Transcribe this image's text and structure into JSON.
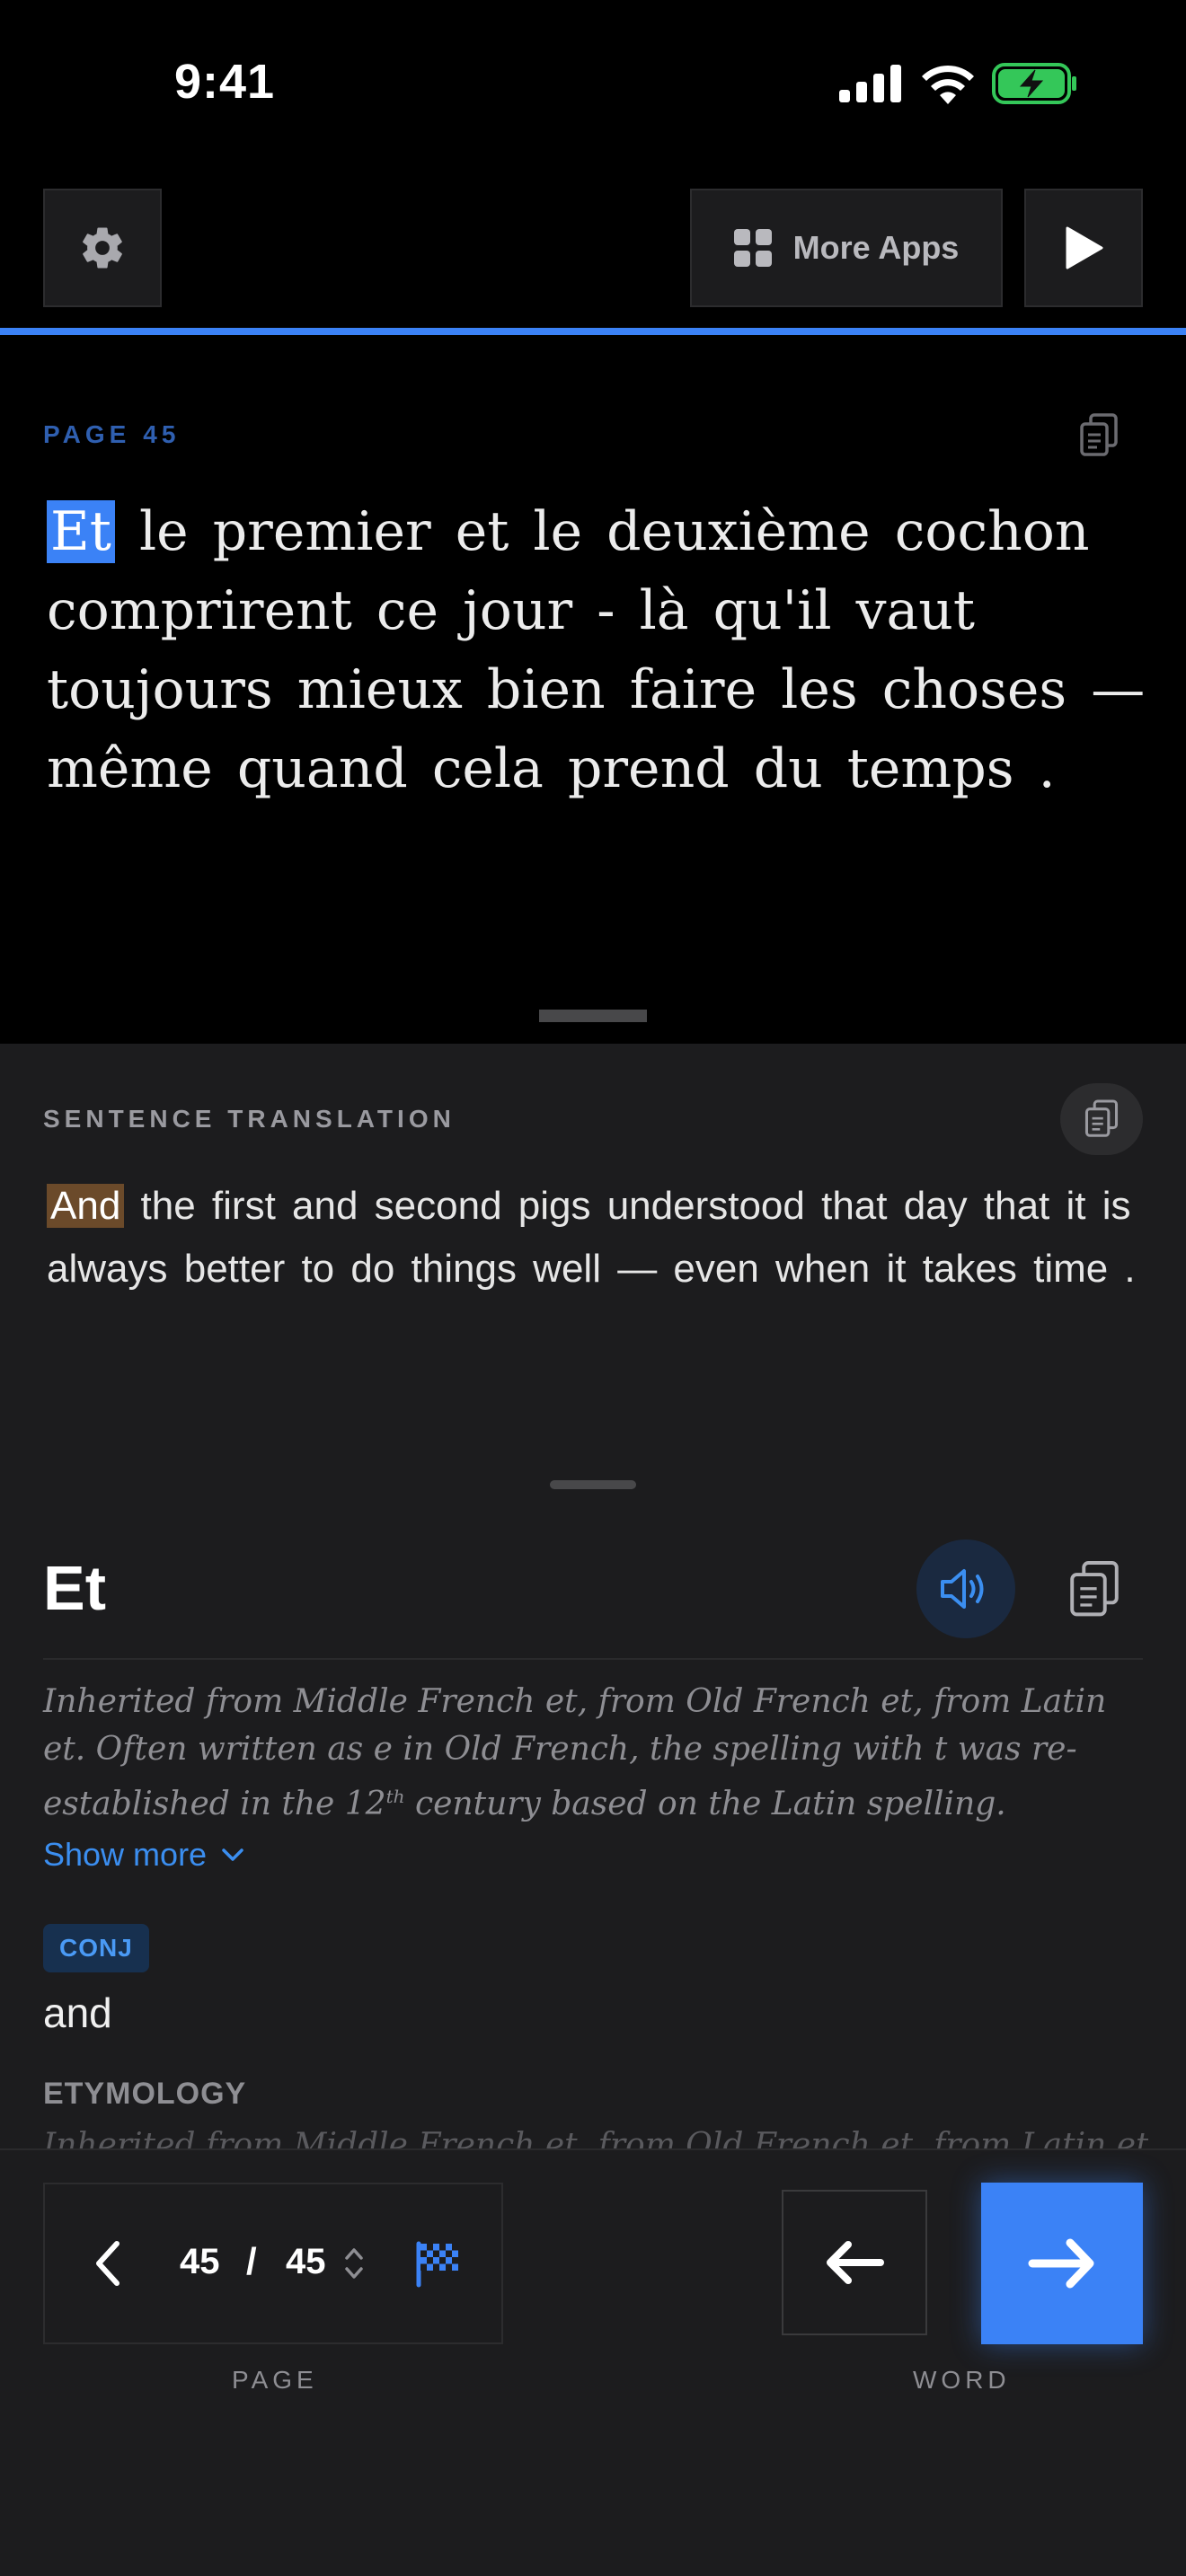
{
  "status_bar": {
    "time": "9:41"
  },
  "top_bar": {
    "more_apps_label": "More Apps"
  },
  "reader": {
    "page_label": "PAGE",
    "page_number": "45",
    "highlighted_word": "Et",
    "text_rest": " le premier et le deuxième cochon comprirent ce jour - là qu'il vaut toujours mieux bien faire les choses — même quand cela prend du temps ."
  },
  "translation": {
    "title": "SENTENCE TRANSLATION",
    "highlighted_word": "And",
    "text_rest": " the first and second pigs understood that day that it is always better to do things well — even when it takes time ."
  },
  "dictionary": {
    "word": "Et",
    "etymology_part1": "Inherited from Middle French et, from Old French et, from Latin et. Often written as e in Old French, the spelling with t was re-established in the 12",
    "etymology_sup": "th",
    "etymology_part2": " century based on the Latin spelling.",
    "show_more": "Show more",
    "pos": "CONJ",
    "meaning": "and",
    "etymology_heading": "ETYMOLOGY",
    "etymology_faded": "Inherited from Middle French et, from Old French et, from Latin et."
  },
  "bottom_bar": {
    "current_page": "45",
    "separator": "/",
    "total_pages": "45",
    "page_caption": "PAGE",
    "word_caption": "WORD"
  },
  "colors": {
    "accent": "#3b82f6",
    "highlight_translation": "#6b4a2a",
    "battery": "#34c759"
  }
}
